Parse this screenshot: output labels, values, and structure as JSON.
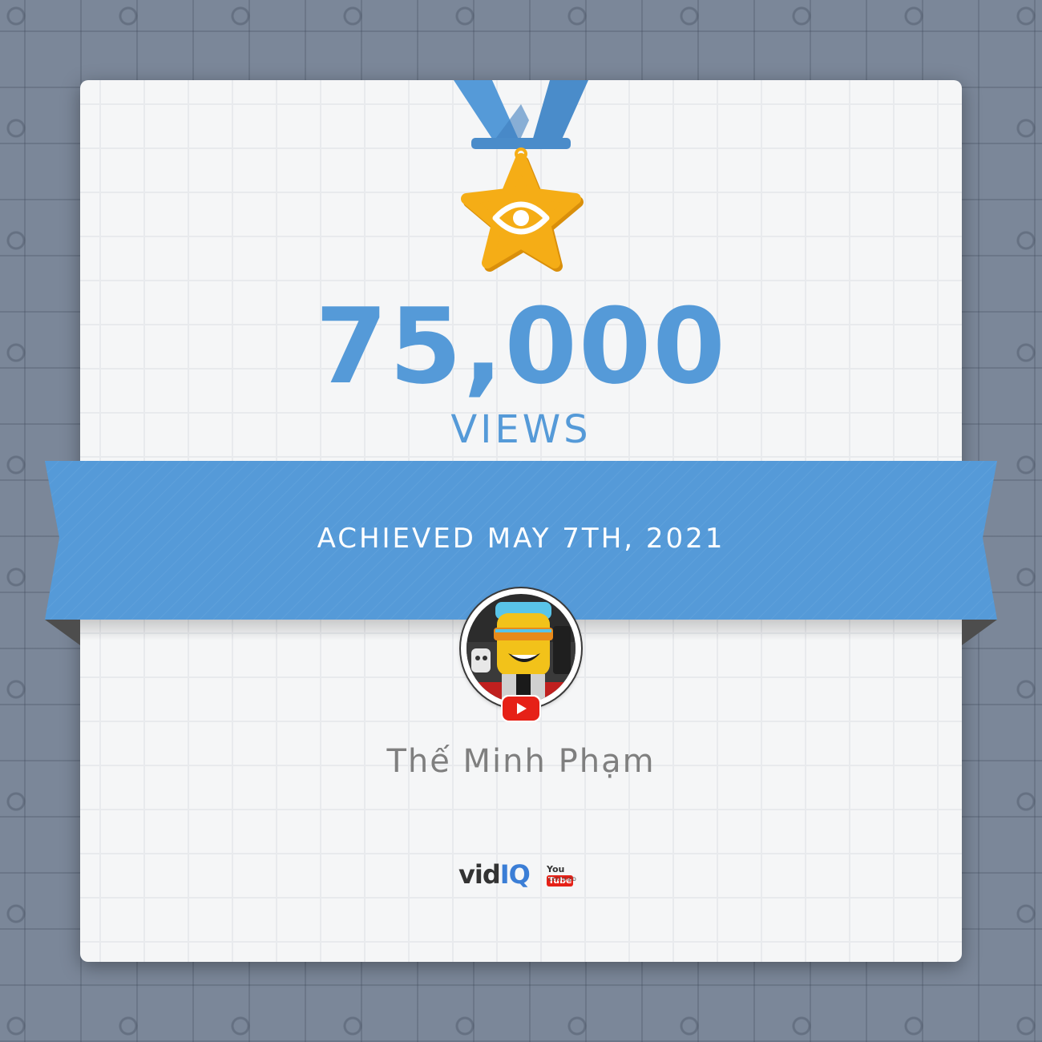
{
  "milestone": {
    "count": "75,000",
    "unit": "VIEWS",
    "achieved": "ACHIEVED MAY 7TH, 2021"
  },
  "channel": {
    "name": "Thế Minh Phạm",
    "avatar_icon": "roblox-avatar-image",
    "platform_icon": "youtube-play-icon"
  },
  "brand": {
    "name_part1": "vid",
    "name_part2": "IQ",
    "cert_you": "You",
    "cert_tube": "Tube",
    "cert_label": "CERTIFIED"
  },
  "colors": {
    "accent_blue": "#559ad8",
    "ribbon_blue": "#559ad8",
    "star_gold": "#f5ad16",
    "background_slate": "#7b8799",
    "card_bg": "#f5f6f7",
    "youtube_red": "#e62117"
  }
}
